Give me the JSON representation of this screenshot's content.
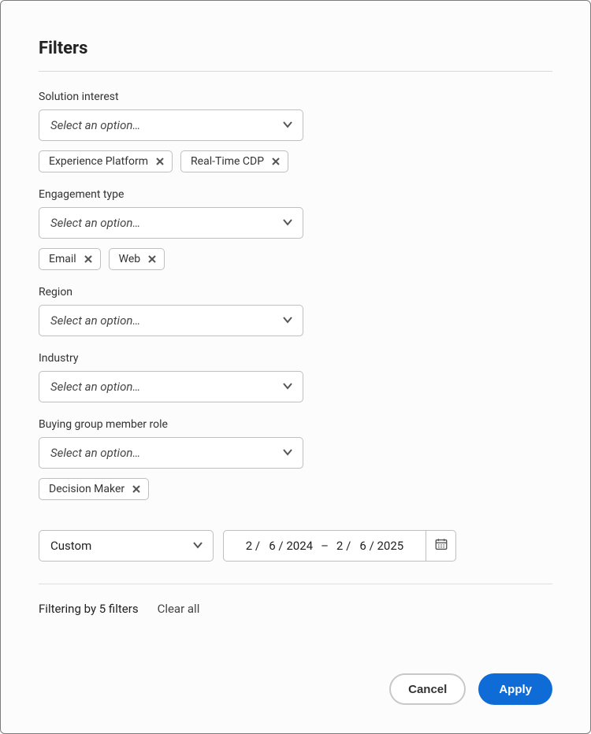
{
  "title": "Filters",
  "filters": {
    "solution": {
      "label": "Solution interest",
      "placeholder": "Select an option…",
      "tags": [
        "Experience Platform",
        "Real-Time CDP"
      ]
    },
    "engagement": {
      "label": "Engagement type",
      "placeholder": "Select an option…",
      "tags": [
        "Email",
        "Web"
      ]
    },
    "region": {
      "label": "Region",
      "placeholder": "Select an option…",
      "tags": []
    },
    "industry": {
      "label": "Industry",
      "placeholder": "Select an option…",
      "tags": []
    },
    "role": {
      "label": "Buying group member role",
      "placeholder": "Select an option…",
      "tags": [
        "Decision Maker"
      ]
    }
  },
  "dateRange": {
    "mode": "Custom",
    "from": "2 /   6 / 2024",
    "to": "2 /   6 / 2025",
    "dash": "–"
  },
  "status": {
    "text": "Filtering by 5 filters",
    "clear": "Clear all"
  },
  "buttons": {
    "cancel": "Cancel",
    "apply": "Apply"
  }
}
